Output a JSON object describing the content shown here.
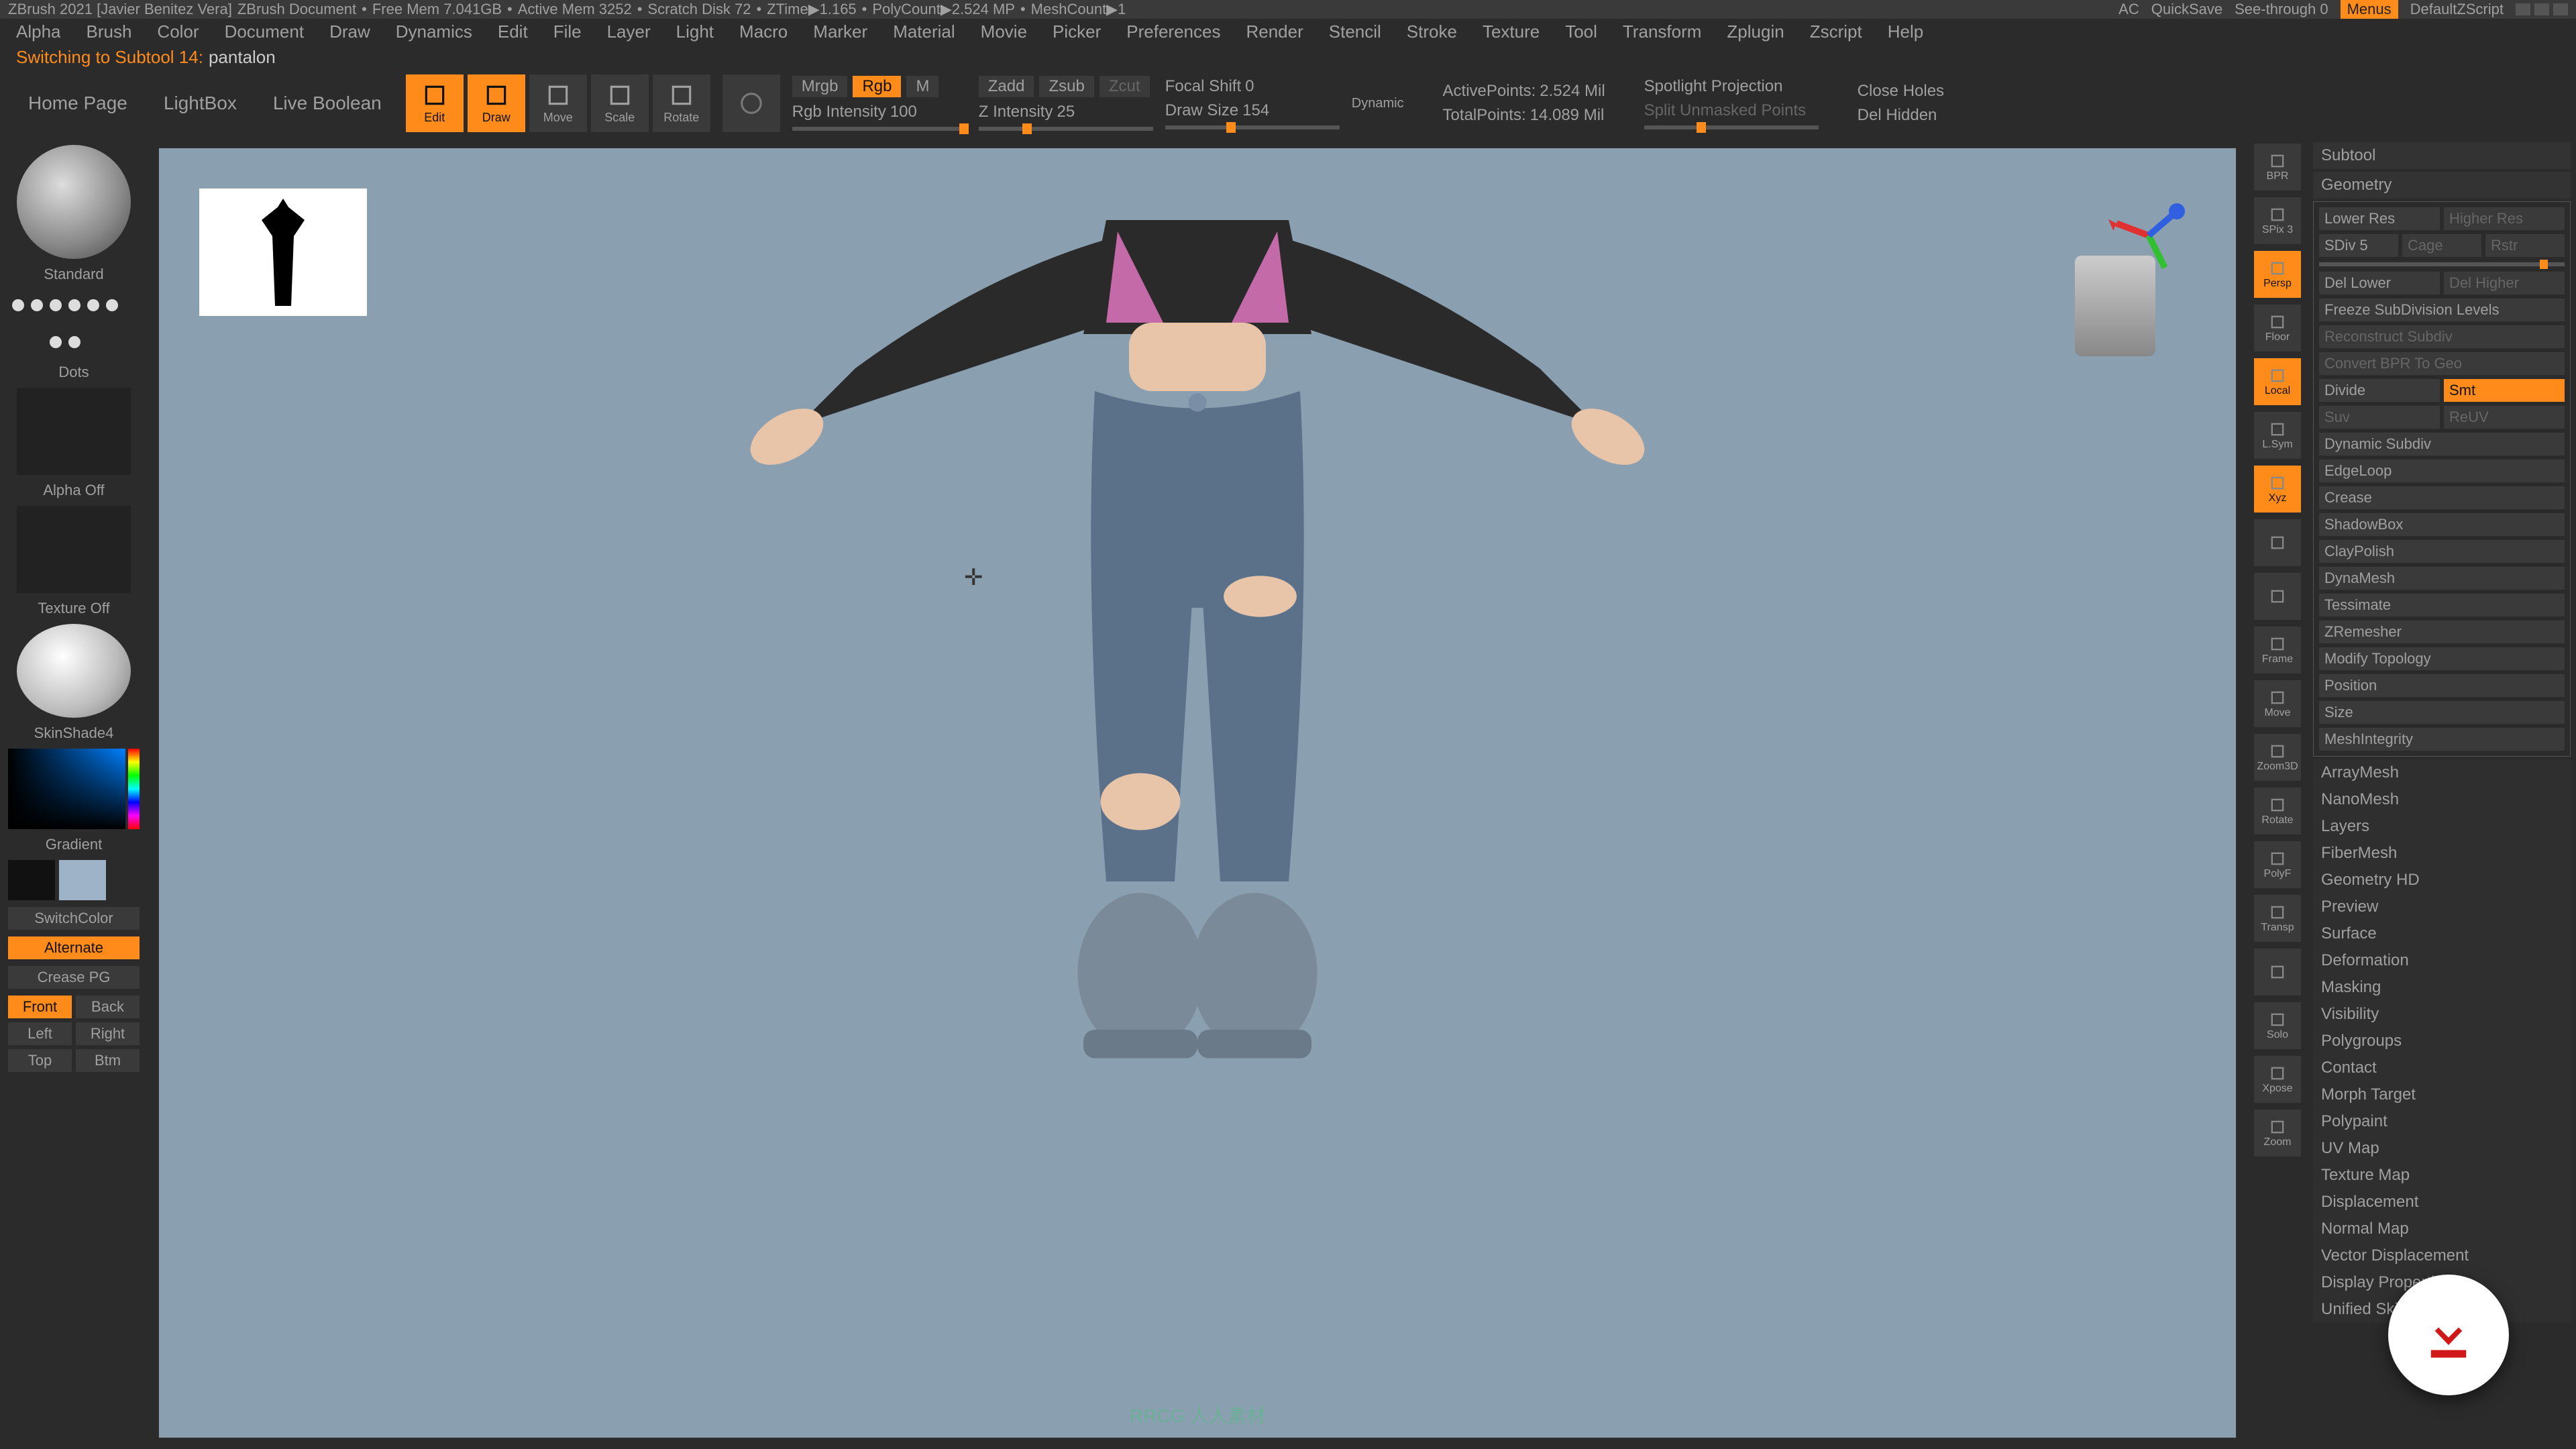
{
  "topbar": {
    "app": "ZBrush 2021 [Javier Benitez Vera]",
    "doc": "ZBrush Document",
    "stats": [
      "Free Mem 7.041GB",
      "Active Mem 3252",
      "Scratch Disk 72",
      "ZTime▶1.165",
      "PolyCount▶2.524 MP",
      "MeshCount▶1"
    ],
    "ac": "AC",
    "quicksave": "QuickSave",
    "seethrough": "See-through  0",
    "menus": "Menus",
    "script": "DefaultZScript"
  },
  "menubar": [
    "Alpha",
    "Brush",
    "Color",
    "Document",
    "Draw",
    "Dynamics",
    "Edit",
    "File",
    "Layer",
    "Light",
    "Macro",
    "Marker",
    "Material",
    "Movie",
    "Picker",
    "Preferences",
    "Render",
    "Stencil",
    "Stroke",
    "Texture",
    "Tool",
    "Transform",
    "Zplugin",
    "Zscript",
    "Help"
  ],
  "status": {
    "prefix": "Switching to Subtool 14:",
    "subtool": "pantalon"
  },
  "toolbar2": {
    "homepage": "Home Page",
    "lightbox": "LightBox",
    "liveboolean": "Live Boolean",
    "icons": [
      {
        "name": "edit-tool",
        "label": "Edit",
        "active": true
      },
      {
        "name": "draw-tool",
        "label": "Draw",
        "active": true
      },
      {
        "name": "move-tool",
        "label": "Move",
        "active": false
      },
      {
        "name": "scale-tool",
        "label": "Scale",
        "active": false
      },
      {
        "name": "rotate-tool",
        "label": "Rotate",
        "active": false
      }
    ],
    "mrgb_row": {
      "Mrgb": "Mrgb",
      "Rgb": "Rgb",
      "M": "M"
    },
    "rgb_intensity": {
      "label": "Rgb Intensity",
      "value": "100"
    },
    "zadd": "Zadd",
    "zsub": "Zsub",
    "zcut": "Zcut",
    "z_intensity": {
      "label": "Z Intensity",
      "value": "25"
    },
    "focal_shift": {
      "label": "Focal Shift",
      "value": "0"
    },
    "draw_size": {
      "label": "Draw Size",
      "value": "154"
    },
    "dynamic": "Dynamic",
    "active_points": {
      "label": "ActivePoints:",
      "value": "2.524 Mil"
    },
    "total_points": {
      "label": "TotalPoints:",
      "value": "14.089 Mil"
    },
    "spotlight": "Spotlight Projection",
    "split_unmasked": "Split Unmasked Points",
    "close_holes": "Close Holes",
    "del_hidden": "Del Hidden"
  },
  "left": {
    "brush": "Standard",
    "stroke": "Dots",
    "alpha": "Alpha Off",
    "texture": "Texture Off",
    "material": "SkinShade4",
    "gradient": "Gradient",
    "switchcolor": "SwitchColor",
    "alternate": "Alternate",
    "creasepg": "Crease PG",
    "front": "Front",
    "back": "Back",
    "left_l": "Left",
    "right_l": "Right",
    "top": "Top",
    "btm": "Btm"
  },
  "rightstrip": [
    "BPR",
    "SPix 3",
    "Persp",
    "Floor",
    "Local",
    "L.Sym",
    "Xyz",
    "",
    "",
    "Frame",
    "Move",
    "Zoom3D",
    "Rotate",
    "PolyF",
    "Transp",
    "",
    "Solo",
    "Xpose",
    "Zoom"
  ],
  "rightpanel": {
    "subtool": "Subtool",
    "geometry": "Geometry",
    "geo_rows": [
      [
        {
          "t": "Lower Res",
          "dim": false
        },
        {
          "t": "Higher Res",
          "dim": true
        }
      ],
      [
        {
          "t": "SDiv 5",
          "dim": false
        },
        {
          "t": "Cage",
          "dim": true
        },
        {
          "t": "Rstr",
          "dim": true
        }
      ],
      [
        {
          "t": "Del Lower",
          "dim": false
        },
        {
          "t": "Del Higher",
          "dim": true
        }
      ],
      [
        {
          "t": "Freeze SubDivision Levels",
          "dim": false
        }
      ],
      [
        {
          "t": "Reconstruct Subdiv",
          "dim": true
        }
      ],
      [
        {
          "t": "Convert BPR To Geo",
          "dim": true
        }
      ],
      [
        {
          "t": "Divide",
          "dim": false
        },
        {
          "t": "Smt",
          "active": true
        }
      ],
      [
        {
          "t": "Suv",
          "dim": true
        },
        {
          "t": "ReUV",
          "dim": true
        }
      ],
      [
        {
          "t": "Dynamic Subdiv",
          "dim": false
        }
      ],
      [
        {
          "t": "EdgeLoop",
          "dim": false
        }
      ],
      [
        {
          "t": "Crease",
          "dim": false
        }
      ],
      [
        {
          "t": "ShadowBox",
          "dim": false
        }
      ],
      [
        {
          "t": "ClayPolish",
          "dim": false
        }
      ],
      [
        {
          "t": "DynaMesh",
          "dim": false
        }
      ],
      [
        {
          "t": "Tessimate",
          "dim": false
        }
      ],
      [
        {
          "t": "ZRemesher",
          "dim": false
        }
      ],
      [
        {
          "t": "Modify Topology",
          "dim": false
        }
      ],
      [
        {
          "t": "Position",
          "dim": false
        }
      ],
      [
        {
          "t": "Size",
          "dim": false
        }
      ],
      [
        {
          "t": "MeshIntegrity",
          "dim": false
        }
      ]
    ],
    "sections": [
      "ArrayMesh",
      "NanoMesh",
      "Layers",
      "FiberMesh",
      "Geometry HD",
      "Preview",
      "Surface",
      "Deformation",
      "Masking",
      "Visibility",
      "Polygroups",
      "Contact",
      "Morph Target",
      "Polypaint",
      "UV Map",
      "Texture Map",
      "Displacement",
      "Normal Map",
      "Vector Displacement",
      "Display Properties",
      "Unified Skin"
    ]
  },
  "watermark": "RRCG 人人素材"
}
